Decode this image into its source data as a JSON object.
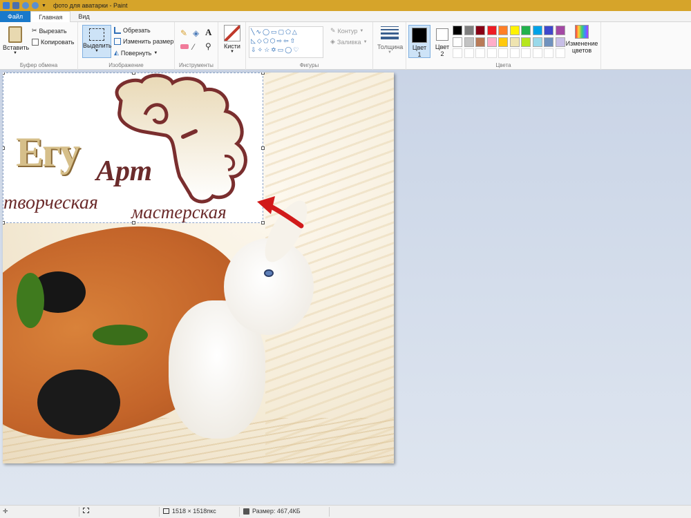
{
  "window": {
    "title": "фото для аватарки - Paint"
  },
  "tabs": {
    "file": "Файл",
    "home": "Главная",
    "view": "Вид"
  },
  "ribbon": {
    "clipboard": {
      "label": "Буфер обмена",
      "paste": "Вставить",
      "cut": "Вырезать",
      "copy": "Копировать"
    },
    "image": {
      "label": "Изображение",
      "select": "Выделить",
      "crop": "Обрезать",
      "resize": "Изменить размер",
      "rotate": "Повернуть"
    },
    "tools": {
      "label": "Инструменты"
    },
    "brushes": {
      "label": "Кисти"
    },
    "shapes": {
      "label": "Фигуры",
      "outline": "Контур",
      "fill": "Заливка"
    },
    "size": {
      "label": "Толщина"
    },
    "colors": {
      "label": "Цвета",
      "color1_line1": "Цвет",
      "color1_line2": "1",
      "color2_line1": "Цвет",
      "color2_line2": "2",
      "edit_line1": "Изменение",
      "edit_line2": "цветов",
      "row1": [
        "#000000",
        "#7f7f7f",
        "#880015",
        "#ed1c24",
        "#ff7f27",
        "#fff200",
        "#22b14c",
        "#00a2e8",
        "#3f48cc",
        "#a349a4"
      ],
      "row2": [
        "#ffffff",
        "#c3c3c3",
        "#b97a57",
        "#ffaec9",
        "#ffc90e",
        "#efe4b0",
        "#b5e61d",
        "#99d9ea",
        "#7092be",
        "#c8bfe7"
      ]
    }
  },
  "canvas": {
    "logo_word1": "Егу",
    "logo_word2": "Арт",
    "tagline1": "творческая",
    "tagline2": "мастерская"
  },
  "status": {
    "dimensions": "1518 × 1518пкс",
    "size": "Размер: 467,4КБ"
  }
}
